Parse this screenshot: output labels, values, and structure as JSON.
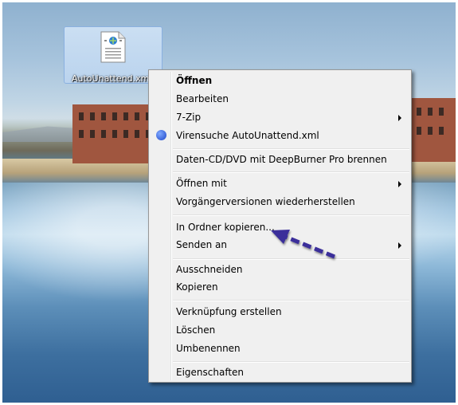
{
  "desktop": {
    "file_icon": {
      "name": "AutoUnattend.xml",
      "icon": "xml-file-icon"
    }
  },
  "context_menu": {
    "items": [
      {
        "label": "Öffnen",
        "bold": true
      },
      {
        "label": "Bearbeiten"
      },
      {
        "label": "7-Zip",
        "submenu": true
      },
      {
        "label": "Virensuche AutoUnattend.xml",
        "icon": "antivirus-icon"
      },
      {
        "label": "Daten-CD/DVD mit DeepBurner Pro brennen"
      },
      {
        "label": "Öffnen mit",
        "submenu": true
      },
      {
        "label": "Vorgängerversionen wiederherstellen"
      },
      {
        "label": "In Ordner kopieren..."
      },
      {
        "label": "Senden an",
        "submenu": true
      },
      {
        "label": "Ausschneiden"
      },
      {
        "label": "Kopieren"
      },
      {
        "label": "Verknüpfung erstellen"
      },
      {
        "label": "Löschen"
      },
      {
        "label": "Umbenennen"
      },
      {
        "label": "Eigenschaften"
      }
    ]
  },
  "annotation": {
    "arrow_color": "#3a2e9a"
  }
}
